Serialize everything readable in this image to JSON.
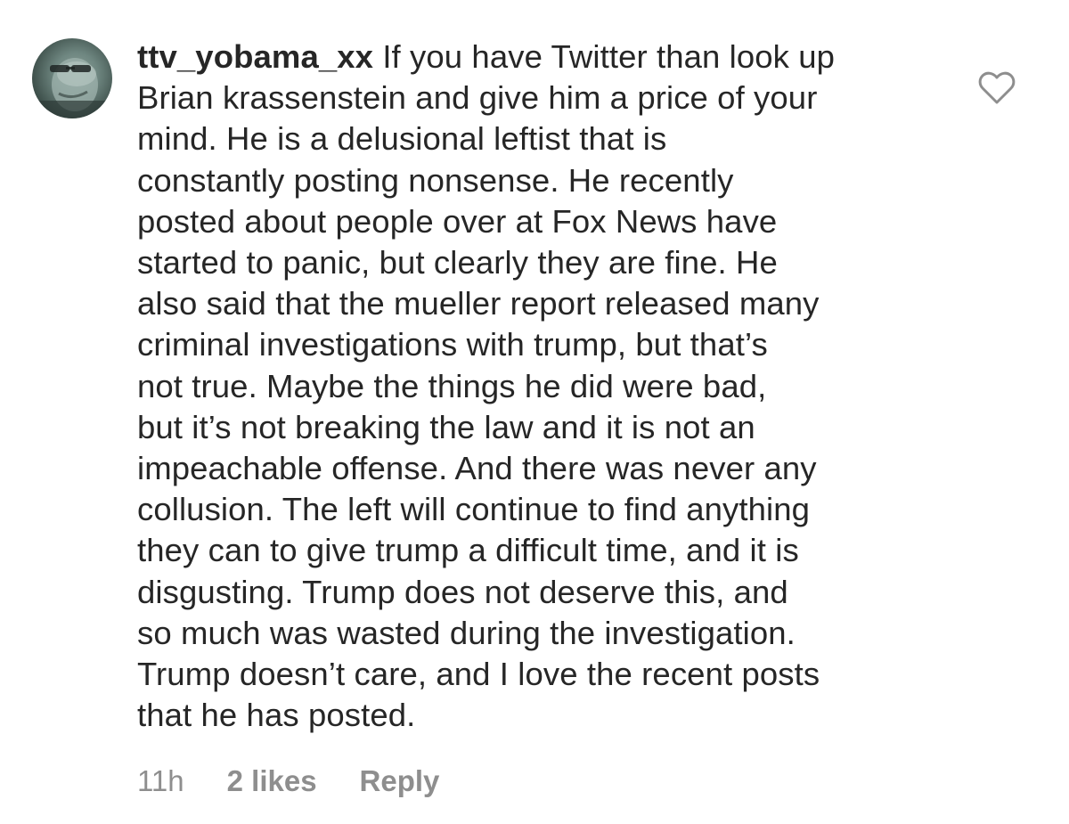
{
  "comment": {
    "username": "ttv_yobama_xx",
    "text": "If you have Twitter than look up\nBrian krassenstein and give him a price of your\nmind. He is a delusional leftist that is\nconstantly posting nonsense. He recently\nposted about people over at Fox News have\nstarted to panic, but clearly they are fine. He\nalso said that the mueller report released many\ncriminal investigations with trump, but that’s\nnot true. Maybe the things he did were bad,\nbut it’s not breaking the law and it is not an\nimpeachable offense. And there was never any\ncollusion. The left will continue to find anything\nthey can to give trump a difficult time, and it is\ndisgusting. Trump does not deserve this, and\nso much was wasted during the investigation.\nTrump doesn’t care, and I love the recent posts\nthat he has posted.",
    "time": "11h",
    "likes": "2 likes",
    "reply_label": "Reply",
    "like_icon": "heart-outline-icon"
  },
  "colors": {
    "text": "#262626",
    "meta": "#8e8e8e",
    "icon": "#8e8e8e",
    "background": "#ffffff"
  }
}
